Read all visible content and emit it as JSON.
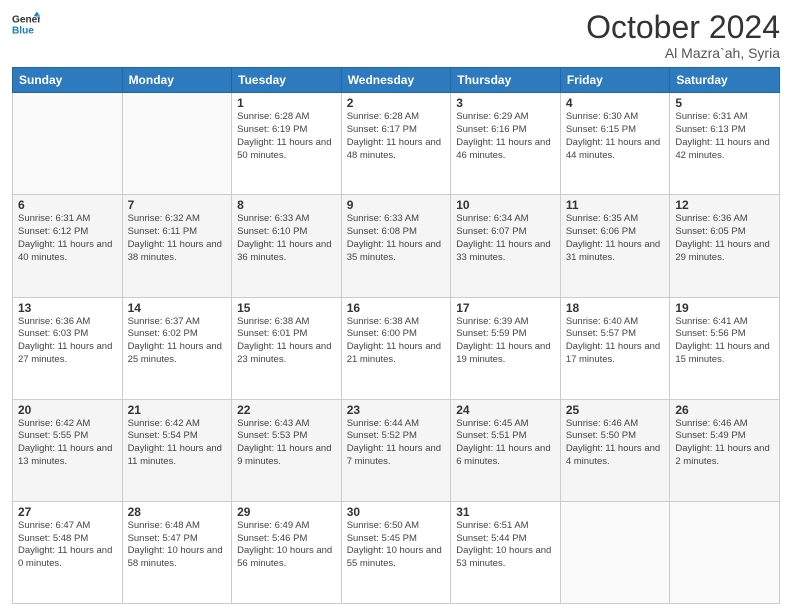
{
  "logo": {
    "line1": "General",
    "line2": "Blue"
  },
  "header": {
    "month": "October 2024",
    "location": "Al Mazra`ah, Syria"
  },
  "weekdays": [
    "Sunday",
    "Monday",
    "Tuesday",
    "Wednesday",
    "Thursday",
    "Friday",
    "Saturday"
  ],
  "weeks": [
    [
      {
        "day": "",
        "sunrise": "",
        "sunset": "",
        "daylight": ""
      },
      {
        "day": "",
        "sunrise": "",
        "sunset": "",
        "daylight": ""
      },
      {
        "day": "1",
        "sunrise": "Sunrise: 6:28 AM",
        "sunset": "Sunset: 6:19 PM",
        "daylight": "Daylight: 11 hours and 50 minutes."
      },
      {
        "day": "2",
        "sunrise": "Sunrise: 6:28 AM",
        "sunset": "Sunset: 6:17 PM",
        "daylight": "Daylight: 11 hours and 48 minutes."
      },
      {
        "day": "3",
        "sunrise": "Sunrise: 6:29 AM",
        "sunset": "Sunset: 6:16 PM",
        "daylight": "Daylight: 11 hours and 46 minutes."
      },
      {
        "day": "4",
        "sunrise": "Sunrise: 6:30 AM",
        "sunset": "Sunset: 6:15 PM",
        "daylight": "Daylight: 11 hours and 44 minutes."
      },
      {
        "day": "5",
        "sunrise": "Sunrise: 6:31 AM",
        "sunset": "Sunset: 6:13 PM",
        "daylight": "Daylight: 11 hours and 42 minutes."
      }
    ],
    [
      {
        "day": "6",
        "sunrise": "Sunrise: 6:31 AM",
        "sunset": "Sunset: 6:12 PM",
        "daylight": "Daylight: 11 hours and 40 minutes."
      },
      {
        "day": "7",
        "sunrise": "Sunrise: 6:32 AM",
        "sunset": "Sunset: 6:11 PM",
        "daylight": "Daylight: 11 hours and 38 minutes."
      },
      {
        "day": "8",
        "sunrise": "Sunrise: 6:33 AM",
        "sunset": "Sunset: 6:10 PM",
        "daylight": "Daylight: 11 hours and 36 minutes."
      },
      {
        "day": "9",
        "sunrise": "Sunrise: 6:33 AM",
        "sunset": "Sunset: 6:08 PM",
        "daylight": "Daylight: 11 hours and 35 minutes."
      },
      {
        "day": "10",
        "sunrise": "Sunrise: 6:34 AM",
        "sunset": "Sunset: 6:07 PM",
        "daylight": "Daylight: 11 hours and 33 minutes."
      },
      {
        "day": "11",
        "sunrise": "Sunrise: 6:35 AM",
        "sunset": "Sunset: 6:06 PM",
        "daylight": "Daylight: 11 hours and 31 minutes."
      },
      {
        "day": "12",
        "sunrise": "Sunrise: 6:36 AM",
        "sunset": "Sunset: 6:05 PM",
        "daylight": "Daylight: 11 hours and 29 minutes."
      }
    ],
    [
      {
        "day": "13",
        "sunrise": "Sunrise: 6:36 AM",
        "sunset": "Sunset: 6:03 PM",
        "daylight": "Daylight: 11 hours and 27 minutes."
      },
      {
        "day": "14",
        "sunrise": "Sunrise: 6:37 AM",
        "sunset": "Sunset: 6:02 PM",
        "daylight": "Daylight: 11 hours and 25 minutes."
      },
      {
        "day": "15",
        "sunrise": "Sunrise: 6:38 AM",
        "sunset": "Sunset: 6:01 PM",
        "daylight": "Daylight: 11 hours and 23 minutes."
      },
      {
        "day": "16",
        "sunrise": "Sunrise: 6:38 AM",
        "sunset": "Sunset: 6:00 PM",
        "daylight": "Daylight: 11 hours and 21 minutes."
      },
      {
        "day": "17",
        "sunrise": "Sunrise: 6:39 AM",
        "sunset": "Sunset: 5:59 PM",
        "daylight": "Daylight: 11 hours and 19 minutes."
      },
      {
        "day": "18",
        "sunrise": "Sunrise: 6:40 AM",
        "sunset": "Sunset: 5:57 PM",
        "daylight": "Daylight: 11 hours and 17 minutes."
      },
      {
        "day": "19",
        "sunrise": "Sunrise: 6:41 AM",
        "sunset": "Sunset: 5:56 PM",
        "daylight": "Daylight: 11 hours and 15 minutes."
      }
    ],
    [
      {
        "day": "20",
        "sunrise": "Sunrise: 6:42 AM",
        "sunset": "Sunset: 5:55 PM",
        "daylight": "Daylight: 11 hours and 13 minutes."
      },
      {
        "day": "21",
        "sunrise": "Sunrise: 6:42 AM",
        "sunset": "Sunset: 5:54 PM",
        "daylight": "Daylight: 11 hours and 11 minutes."
      },
      {
        "day": "22",
        "sunrise": "Sunrise: 6:43 AM",
        "sunset": "Sunset: 5:53 PM",
        "daylight": "Daylight: 11 hours and 9 minutes."
      },
      {
        "day": "23",
        "sunrise": "Sunrise: 6:44 AM",
        "sunset": "Sunset: 5:52 PM",
        "daylight": "Daylight: 11 hours and 7 minutes."
      },
      {
        "day": "24",
        "sunrise": "Sunrise: 6:45 AM",
        "sunset": "Sunset: 5:51 PM",
        "daylight": "Daylight: 11 hours and 6 minutes."
      },
      {
        "day": "25",
        "sunrise": "Sunrise: 6:46 AM",
        "sunset": "Sunset: 5:50 PM",
        "daylight": "Daylight: 11 hours and 4 minutes."
      },
      {
        "day": "26",
        "sunrise": "Sunrise: 6:46 AM",
        "sunset": "Sunset: 5:49 PM",
        "daylight": "Daylight: 11 hours and 2 minutes."
      }
    ],
    [
      {
        "day": "27",
        "sunrise": "Sunrise: 6:47 AM",
        "sunset": "Sunset: 5:48 PM",
        "daylight": "Daylight: 11 hours and 0 minutes."
      },
      {
        "day": "28",
        "sunrise": "Sunrise: 6:48 AM",
        "sunset": "Sunset: 5:47 PM",
        "daylight": "Daylight: 10 hours and 58 minutes."
      },
      {
        "day": "29",
        "sunrise": "Sunrise: 6:49 AM",
        "sunset": "Sunset: 5:46 PM",
        "daylight": "Daylight: 10 hours and 56 minutes."
      },
      {
        "day": "30",
        "sunrise": "Sunrise: 6:50 AM",
        "sunset": "Sunset: 5:45 PM",
        "daylight": "Daylight: 10 hours and 55 minutes."
      },
      {
        "day": "31",
        "sunrise": "Sunrise: 6:51 AM",
        "sunset": "Sunset: 5:44 PM",
        "daylight": "Daylight: 10 hours and 53 minutes."
      },
      {
        "day": "",
        "sunrise": "",
        "sunset": "",
        "daylight": ""
      },
      {
        "day": "",
        "sunrise": "",
        "sunset": "",
        "daylight": ""
      }
    ]
  ]
}
